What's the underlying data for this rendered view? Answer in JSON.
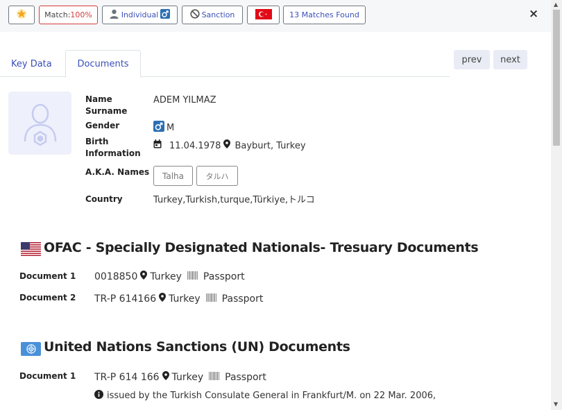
{
  "toolbar": {
    "match_prefix": "Match: ",
    "match_value": "100%",
    "individual_label": "Individual",
    "sanction_label": "Sanction",
    "matches_found": "13 Matches Found",
    "close": "×"
  },
  "tabs": [
    {
      "label": "Key Data",
      "active": false
    },
    {
      "label": "Documents",
      "active": true
    }
  ],
  "nav": {
    "prev": "prev",
    "next": "next"
  },
  "profile": {
    "name_label_1": "Name",
    "name_label_2": "Surname",
    "name": "ADEM YILMAZ",
    "gender_label": "Gender",
    "gender": "M",
    "birth_label_1": "Birth",
    "birth_label_2": "Information",
    "birth_date": "11.04.1978",
    "birth_place": "Bayburt, Turkey",
    "aka_label": "A.K.A. Names",
    "aka": [
      "Talha",
      "タルハ"
    ],
    "country_label": "Country",
    "country": "Turkey,Turkish,turque,Türkiye,トルコ"
  },
  "sections": [
    {
      "title": "OFAC - Specially Designated Nationals- Tresuary Documents",
      "flag": "us-flag",
      "documents": [
        {
          "label": "Document 1",
          "number": "0018850",
          "country": "Turkey",
          "type": "Passport"
        },
        {
          "label": "Document 2",
          "number": "TR-P 614166",
          "country": "Turkey",
          "type": "Passport"
        }
      ]
    },
    {
      "title": "United Nations Sanctions (UN) Documents",
      "flag": "un-flag",
      "documents": [
        {
          "label": "Document 1",
          "number": "TR-P 614 166",
          "country": "Turkey",
          "type": "Passport",
          "note": "issued by the Turkish Consulate General in Frankfurt/M. on 22 Mar. 2006,"
        }
      ]
    }
  ],
  "colors": {
    "accent": "#3a4fb8",
    "match_red": "#d43c3c",
    "toolbar_bg": "#f6f7f9"
  }
}
